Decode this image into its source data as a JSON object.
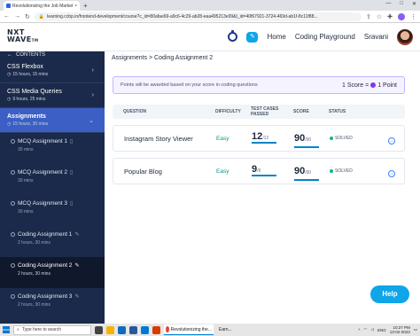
{
  "browser": {
    "tab_title": "Revolutionizing the Job Market |",
    "tab_close": "×",
    "new_tab": "+",
    "window_controls": [
      "—",
      "□",
      "✕"
    ],
    "url": "learning.ccbp.in/frontend-development/course?c_id=80afae69-a9c6-4c29-ab28-eaa495213e99&t_id=40f67921-3724-469d-ab1f-8c11f88...",
    "icons": [
      "share-icon",
      "star-icon",
      "extension-icon",
      "profile-icon",
      "menu-icon"
    ]
  },
  "header": {
    "logo_line1": "NXT",
    "logo_line2": "WAVE",
    "logo_tm": "TM",
    "home": "Home",
    "coding_playground": "Coding Playground",
    "user_name": "Sravani"
  },
  "sidebar": {
    "contents_label": "CONTENTS",
    "sections": [
      {
        "title": "CSS Flexbox",
        "meta": "15 hours, 15 mins"
      },
      {
        "title": "CSS Media Queries",
        "meta": "9 hours, 25 mins"
      },
      {
        "title": "Assignments",
        "meta": "15 hours, 30 mins"
      }
    ],
    "items": [
      {
        "title": "MCQ Assignment 1",
        "meta": "30 mins"
      },
      {
        "title": "MCQ Assignment 2",
        "meta": "30 mins"
      },
      {
        "title": "MCQ Assignment 3",
        "meta": "30 mins"
      },
      {
        "title": "Coding Assignment 1",
        "meta": "2 hours, 30 mins"
      },
      {
        "title": "Coding Assignment 2",
        "meta": "2 hours, 30 mins"
      },
      {
        "title": "Coding Assignment 3",
        "meta": "2 hours, 30 mins"
      }
    ]
  },
  "main": {
    "breadcrumb": "Assignments > Coding Assignment 2",
    "info_text": "Points will be awarded based on your score in coding questions",
    "score_rule_left": "1 Score =",
    "score_rule_right": "1 Point",
    "columns": {
      "question": "QUESTION",
      "difficulty": "DIFFICULTY",
      "test_cases_1": "TEST CASES",
      "test_cases_2": "PASSED",
      "score": "SCORE",
      "status": "STATUS"
    },
    "rows": [
      {
        "question": "Instagram Story Viewer",
        "difficulty": "Easy",
        "tc": "12",
        "tc_total": "/12",
        "score": "90",
        "score_total": "/90",
        "status": "SOLVED"
      },
      {
        "question": "Popular Blog",
        "difficulty": "Easy",
        "tc": "9",
        "tc_total": "/9",
        "score": "90",
        "score_total": "/90",
        "status": "SOLVED"
      }
    ],
    "help": "Help"
  },
  "taskbar": {
    "search_placeholder": "Type here to search",
    "active_app": "Revolutionizing the...",
    "second_app": "Earn...",
    "lang": "ENG",
    "time": "10:27 PM",
    "date": "13-02-2023"
  }
}
